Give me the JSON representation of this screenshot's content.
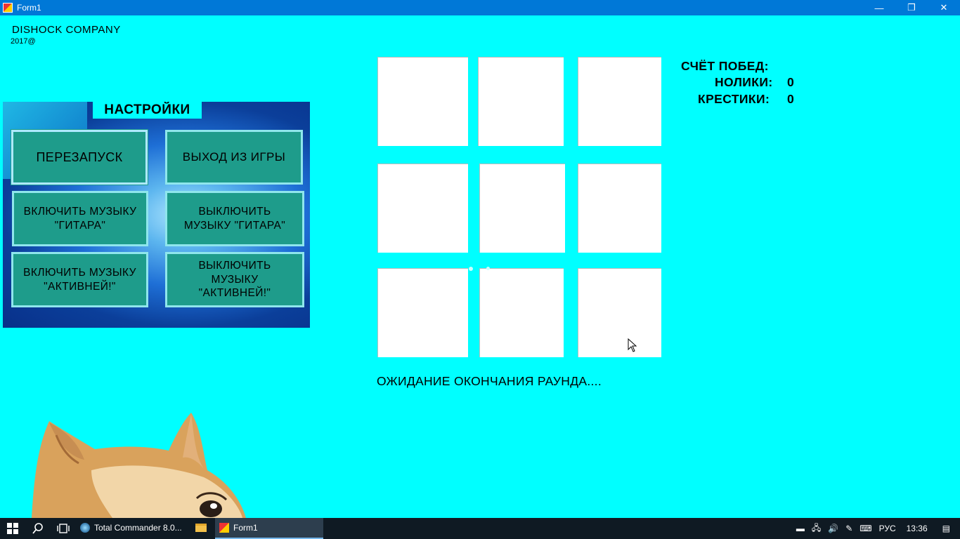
{
  "window": {
    "title": "Form1",
    "minimize": "—",
    "restore": "❐",
    "close": "✕"
  },
  "header": {
    "company": "DISHOCK COMPANY",
    "year": "2017@"
  },
  "settings": {
    "title": "НАСТРОЙКИ",
    "restart": "ПЕРЕЗАПУСК",
    "exit": "ВЫХОД ИЗ ИГРЫ",
    "guitar_on": "ВКЛЮЧИТЬ МУЗЫКУ \"ГИТАРА\"",
    "guitar_off": "ВЫКЛЮЧИТЬ МУЗЫКУ \"ГИТАРА\"",
    "active_on": "ВКЛЮЧИТЬ МУЗЫКУ \"АКТИВНЕЙ!\"",
    "active_off": "ВЫКЛЮЧИТЬ МУЗЫКУ \"АКТИВНЕЙ!\""
  },
  "board": {
    "cells": [
      "",
      "",
      "",
      "",
      "",
      "",
      "",
      "",
      ""
    ]
  },
  "status": "ОЖИДАНИЕ ОКОНЧАНИЯ РАУНДА....",
  "score": {
    "title": "СЧЁТ ПОБЕД:",
    "noughts_label": "НОЛИКИ:",
    "noughts_value": "0",
    "crosses_label": "КРЕСТИКИ:",
    "crosses_value": "0"
  },
  "taskbar": {
    "items": [
      {
        "label": "Total Commander 8.0...",
        "icon": "total-commander-icon"
      },
      {
        "label": "",
        "icon": "file-explorer-icon"
      },
      {
        "label": "Form1",
        "icon": "form-app-icon",
        "active": true
      }
    ],
    "language": "РУС",
    "time": "13:36"
  }
}
